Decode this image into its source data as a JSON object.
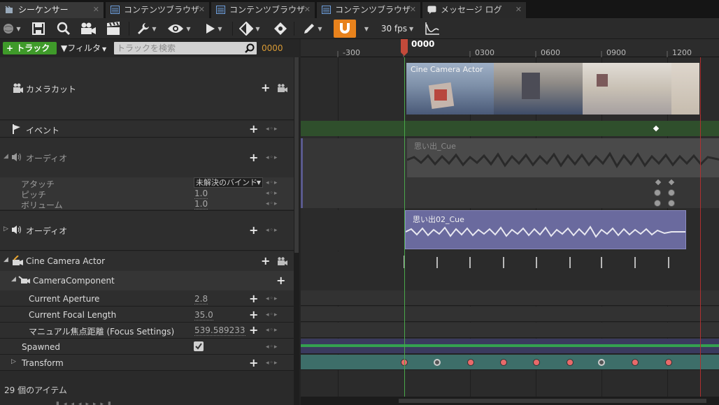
{
  "tabs": [
    {
      "label": "シーケンサー",
      "icon": "sequencer-icon",
      "active": true
    },
    {
      "label": "コンテンツブラウザ",
      "icon": "content-browser-icon",
      "active": false
    },
    {
      "label": "コンテンツブラウザ",
      "icon": "content-browser-icon",
      "active": false
    },
    {
      "label": "コンテンツブラウザ",
      "icon": "content-browser-icon",
      "active": false
    },
    {
      "label": "メッセージ ログ",
      "icon": "message-log-icon",
      "active": false
    }
  ],
  "toolbar": {
    "fps": "30 fps",
    "snap_color": "#e8821c"
  },
  "filterbar": {
    "track_label": "トラック",
    "filter_label": "フィルタ",
    "search_placeholder": "トラックを検索",
    "current_frame": "0000"
  },
  "ruler": {
    "playhead": "0000",
    "ticks": [
      "-300",
      "0300",
      "0600",
      "0900",
      "1200"
    ]
  },
  "tracks": {
    "camera_cut": {
      "label": "カメラカット",
      "section": "Cine Camera Actor"
    },
    "event": {
      "label": "イベント"
    },
    "audio1": {
      "label": "オーディオ",
      "section": "思い出_Cue",
      "attach": {
        "label": "アタッチ",
        "value": "未解決のバインド"
      },
      "pitch": {
        "label": "ピッチ",
        "value": "1.0"
      },
      "volume": {
        "label": "ボリューム",
        "value": "1.0"
      }
    },
    "audio2": {
      "label": "オーディオ",
      "section": "思い出02_Cue"
    },
    "actor": {
      "label": "Cine Camera Actor"
    },
    "component": {
      "label": "CameraComponent"
    },
    "aperture": {
      "label": "Current Aperture",
      "value": "2.8"
    },
    "focal": {
      "label": "Current Focal Length",
      "value": "35.0"
    },
    "focus": {
      "label": "マニュアル焦点距離 (Focus Settings)",
      "value": "539.589233"
    },
    "spawned": {
      "label": "Spawned",
      "checked": true
    },
    "transform": {
      "label": "Transform"
    }
  },
  "footer": {
    "item_count": "29 個のアイテム"
  },
  "colors": {
    "track_green": "#3f9a2a",
    "event_lane": "#2f4f2c",
    "audio2_lane": "#6a6a9e",
    "transform_lane": "#3d6e69",
    "playhead": "#c24a3a",
    "key_red": "#e86a6a"
  }
}
